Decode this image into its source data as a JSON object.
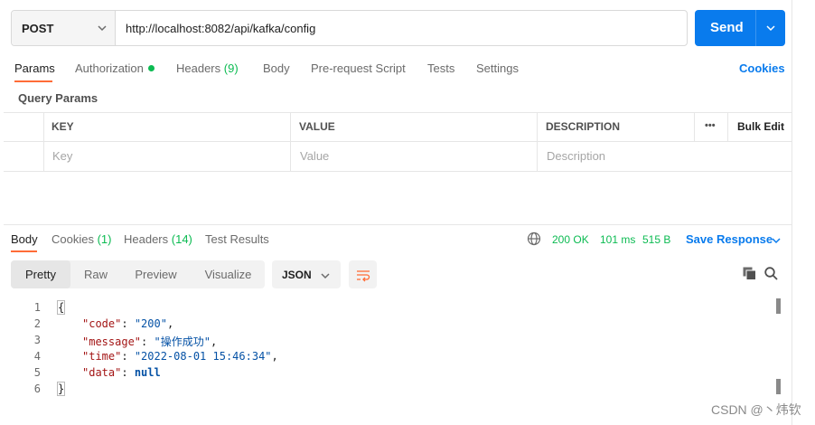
{
  "request": {
    "method": "POST",
    "url": "http://localhost:8082/api/kafka/config",
    "send_label": "Send"
  },
  "request_tabs": {
    "params": "Params",
    "authorization": "Authorization",
    "headers": "Headers",
    "headers_count": "(9)",
    "body": "Body",
    "pre_request_script": "Pre-request Script",
    "tests": "Tests",
    "settings": "Settings",
    "cookies": "Cookies"
  },
  "query_params": {
    "title": "Query Params",
    "columns": {
      "key": "KEY",
      "value": "VALUE",
      "description": "DESCRIPTION",
      "more": "•••",
      "bulk_edit": "Bulk Edit"
    },
    "placeholders": {
      "key": "Key",
      "value": "Value",
      "description": "Description"
    }
  },
  "response": {
    "tabs": {
      "body": "Body",
      "cookies": "Cookies",
      "cookies_count": "(1)",
      "headers": "Headers",
      "headers_count": "(14)",
      "test_results": "Test Results"
    },
    "status": "200 OK",
    "time": "101 ms",
    "size": "515 B",
    "save_response": "Save Response",
    "view_modes": [
      "Pretty",
      "Raw",
      "Preview",
      "Visualize"
    ],
    "format": "JSON",
    "line_numbers": [
      "1",
      "2",
      "3",
      "4",
      "5",
      "6"
    ],
    "json": {
      "open": "{",
      "close": "}",
      "code_key": "\"code\"",
      "code_value": "\"200\"",
      "message_key": "\"message\"",
      "message_value": "\"操作成功\"",
      "time_key": "\"time\"",
      "time_value": "\"2022-08-01 15:46:34\"",
      "data_key": "\"data\"",
      "data_value": "null"
    }
  },
  "icons": {
    "method_dropdown": "chevron-down-icon",
    "send_dropdown": "chevron-down-icon",
    "globe": "globe-icon",
    "wrap": "wrap-lines-icon",
    "copy": "copy-icon",
    "search": "search-icon"
  },
  "colors": {
    "accent": "#ff6c37",
    "primary": "#097bed",
    "success": "#0cbb52"
  },
  "watermark": "CSDN @丶炜钦"
}
